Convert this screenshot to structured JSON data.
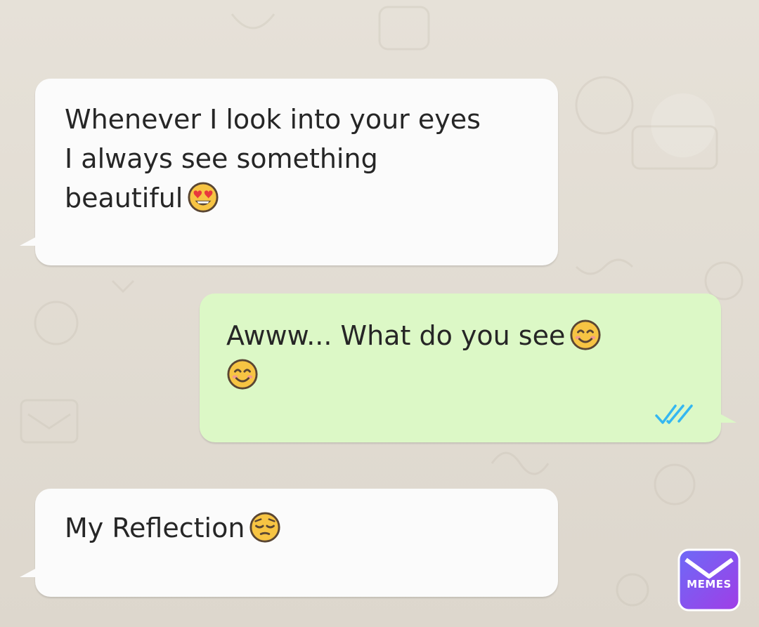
{
  "messages": [
    {
      "direction": "incoming",
      "lines": [
        "Whenever I look into your eyes",
        "I always see something",
        "beautiful"
      ],
      "emoji": [
        "heart-eyes-emoji"
      ]
    },
    {
      "direction": "outgoing",
      "lines": [
        "Awww... What do you see"
      ],
      "emoji": [
        "smiling-emoji",
        "smiling-emoji"
      ],
      "status": "read"
    },
    {
      "direction": "incoming",
      "lines": [
        "My Reflection"
      ],
      "emoji": [
        "pensive-emoji"
      ]
    }
  ],
  "watermark": {
    "label": "MEMES",
    "icon": "mail-icon",
    "color": "#8b4ef0"
  },
  "colors": {
    "incoming_bubble": "#fbfbfb",
    "outgoing_bubble": "#dcf8c6",
    "read_ticks": "#34b7f1",
    "chat_background": "#e4dfd6"
  }
}
